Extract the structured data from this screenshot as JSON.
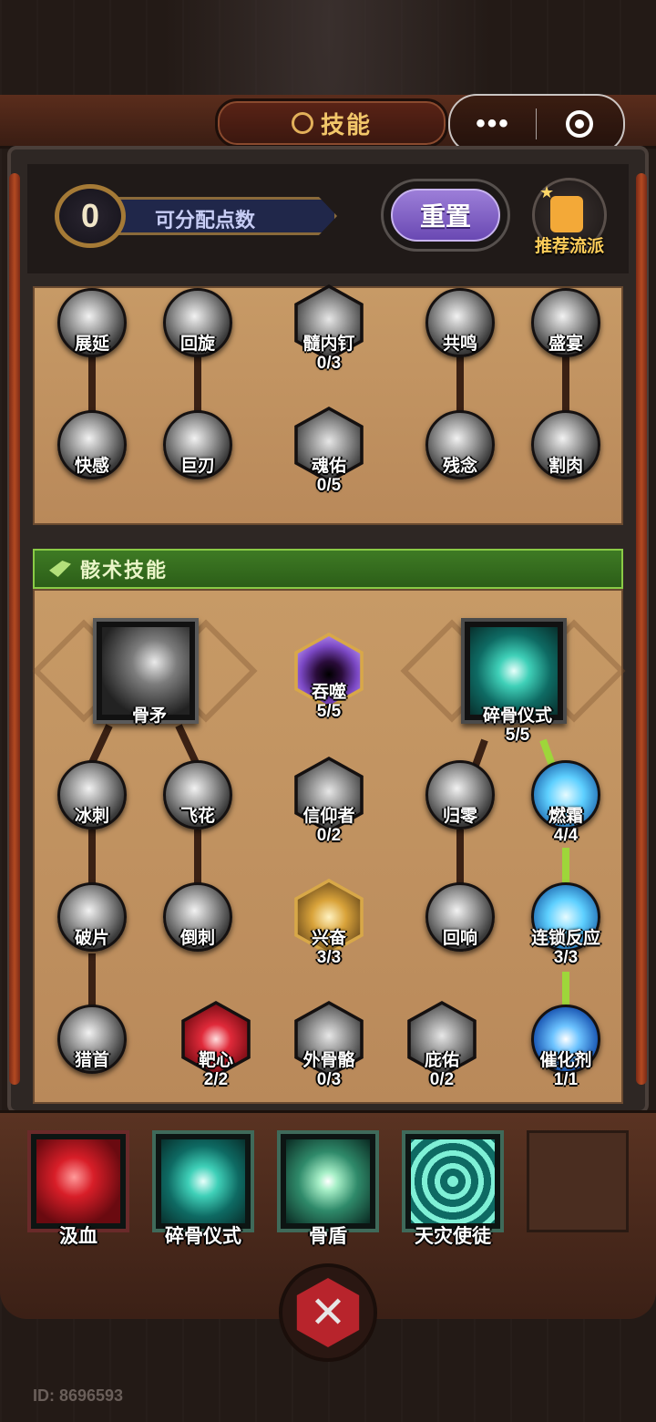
{
  "header": {
    "title": "技能",
    "available_points_value": "0",
    "available_points_label": "可分配点数",
    "reset_label": "重置",
    "recommend_label": "推荐流派"
  },
  "capsule": {
    "more": "•••"
  },
  "section1": {
    "nodes": [
      {
        "name": "展延",
        "level": ""
      },
      {
        "name": "回旋",
        "level": ""
      },
      {
        "name": "髓内钉",
        "level": "0/3"
      },
      {
        "name": "共鸣",
        "level": ""
      },
      {
        "name": "盛宴",
        "level": ""
      },
      {
        "name": "快感",
        "level": ""
      },
      {
        "name": "巨刃",
        "level": ""
      },
      {
        "name": "魂佑",
        "level": "0/5"
      },
      {
        "name": "残念",
        "level": ""
      },
      {
        "name": "割肉",
        "level": ""
      }
    ]
  },
  "section2": {
    "category": "骸术技能",
    "big_nodes": [
      {
        "name": "骨矛",
        "level": ""
      },
      {
        "name": "碎骨仪式",
        "level": "5/5"
      }
    ],
    "nodes": [
      {
        "name": "吞噬",
        "level": "5/5"
      },
      {
        "name": "冰刺",
        "level": ""
      },
      {
        "name": "飞花",
        "level": ""
      },
      {
        "name": "信仰者",
        "level": "0/2"
      },
      {
        "name": "归零",
        "level": ""
      },
      {
        "name": "燃霜",
        "level": "4/4"
      },
      {
        "name": "破片",
        "level": ""
      },
      {
        "name": "倒刺",
        "level": ""
      },
      {
        "name": "兴奋",
        "level": "3/3"
      },
      {
        "name": "回响",
        "level": ""
      },
      {
        "name": "连锁反应",
        "level": "3/3"
      },
      {
        "name": "猎首",
        "level": ""
      },
      {
        "name": "靶心",
        "level": "2/2"
      },
      {
        "name": "外骨骼",
        "level": "0/3"
      },
      {
        "name": "庇佑",
        "level": "0/2"
      },
      {
        "name": "催化剂",
        "level": "1/1"
      }
    ]
  },
  "equipped": [
    {
      "name": "汲血"
    },
    {
      "name": "碎骨仪式"
    },
    {
      "name": "骨盾"
    },
    {
      "name": "天灾使徒"
    },
    {
      "name": ""
    }
  ],
  "footer": {
    "id_text": "ID: 8696593"
  },
  "colors": {
    "accent_gold": "#f2c76a",
    "category_green": "#3e7a24",
    "active_link": "#9ed63a",
    "reset_purple": "#7e5cc6"
  }
}
